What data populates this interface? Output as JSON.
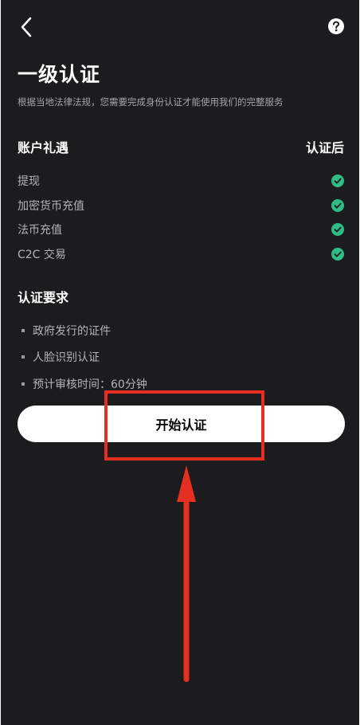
{
  "header": {
    "back_icon": "chevron-left-icon",
    "help_icon": "question-circle-icon"
  },
  "page": {
    "title": "一级认证",
    "subtitle": "根据当地法律法规，您需要完成身份认证才能使用我们的完整服务"
  },
  "benefits": {
    "title": "账户礼遇",
    "column_label": "认证后",
    "check_color": "#2fbd85",
    "items": [
      {
        "label": "提现"
      },
      {
        "label": "加密货币充值"
      },
      {
        "label": "法币充值"
      },
      {
        "label": "C2C 交易"
      }
    ]
  },
  "requirements": {
    "title": "认证要求",
    "items": [
      {
        "label": "政府发行的证件"
      },
      {
        "label": "人脸识别认证"
      },
      {
        "label": "预计审核时间：60分钟"
      }
    ]
  },
  "action": {
    "start_label": "开始认证"
  },
  "annotation": {
    "color": "#e53021"
  }
}
